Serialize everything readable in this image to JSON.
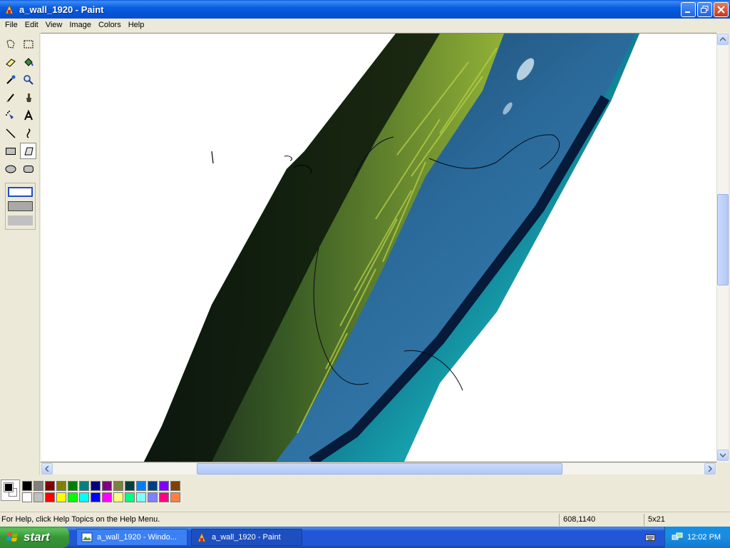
{
  "window": {
    "title": "a_wall_1920 - Paint"
  },
  "menu": [
    "File",
    "Edit",
    "View",
    "Image",
    "Colors",
    "Help"
  ],
  "tools": [
    {
      "name": "free-form-select-tool"
    },
    {
      "name": "select-tool"
    },
    {
      "name": "eraser-tool"
    },
    {
      "name": "fill-with-color-tool"
    },
    {
      "name": "pick-color-tool"
    },
    {
      "name": "magnifier-tool"
    },
    {
      "name": "pencil-tool"
    },
    {
      "name": "brush-tool"
    },
    {
      "name": "airbrush-tool"
    },
    {
      "name": "text-tool"
    },
    {
      "name": "line-tool"
    },
    {
      "name": "curve-tool"
    },
    {
      "name": "rectangle-tool"
    },
    {
      "name": "polygon-tool",
      "selected": true
    },
    {
      "name": "ellipse-tool"
    },
    {
      "name": "rounded-rectangle-tool"
    }
  ],
  "colors": {
    "foreground": "#000000",
    "background": "#ffffff",
    "palette_row1": [
      "#000000",
      "#808080",
      "#800000",
      "#808000",
      "#008000",
      "#008080",
      "#000080",
      "#800080",
      "#808040",
      "#004040",
      "#0080ff",
      "#004080",
      "#8000ff",
      "#804000"
    ],
    "palette_row2": [
      "#ffffff",
      "#c0c0c0",
      "#ff0000",
      "#ffff00",
      "#00ff00",
      "#00ffff",
      "#0000ff",
      "#ff00ff",
      "#ffff80",
      "#00ff80",
      "#80ffff",
      "#8080ff",
      "#ff0080",
      "#ff8040"
    ]
  },
  "status": {
    "help_text": "For Help, click Help Topics on the Help Menu.",
    "coordinates": "608,1140",
    "size": "5x21"
  },
  "taskbar": {
    "start_label": "start",
    "tasks": [
      {
        "label": "a_wall_1920 - Windo...",
        "active": false
      },
      {
        "label": "a_wall_1920 - Paint",
        "active": true
      }
    ],
    "clock": "12:02 PM"
  }
}
